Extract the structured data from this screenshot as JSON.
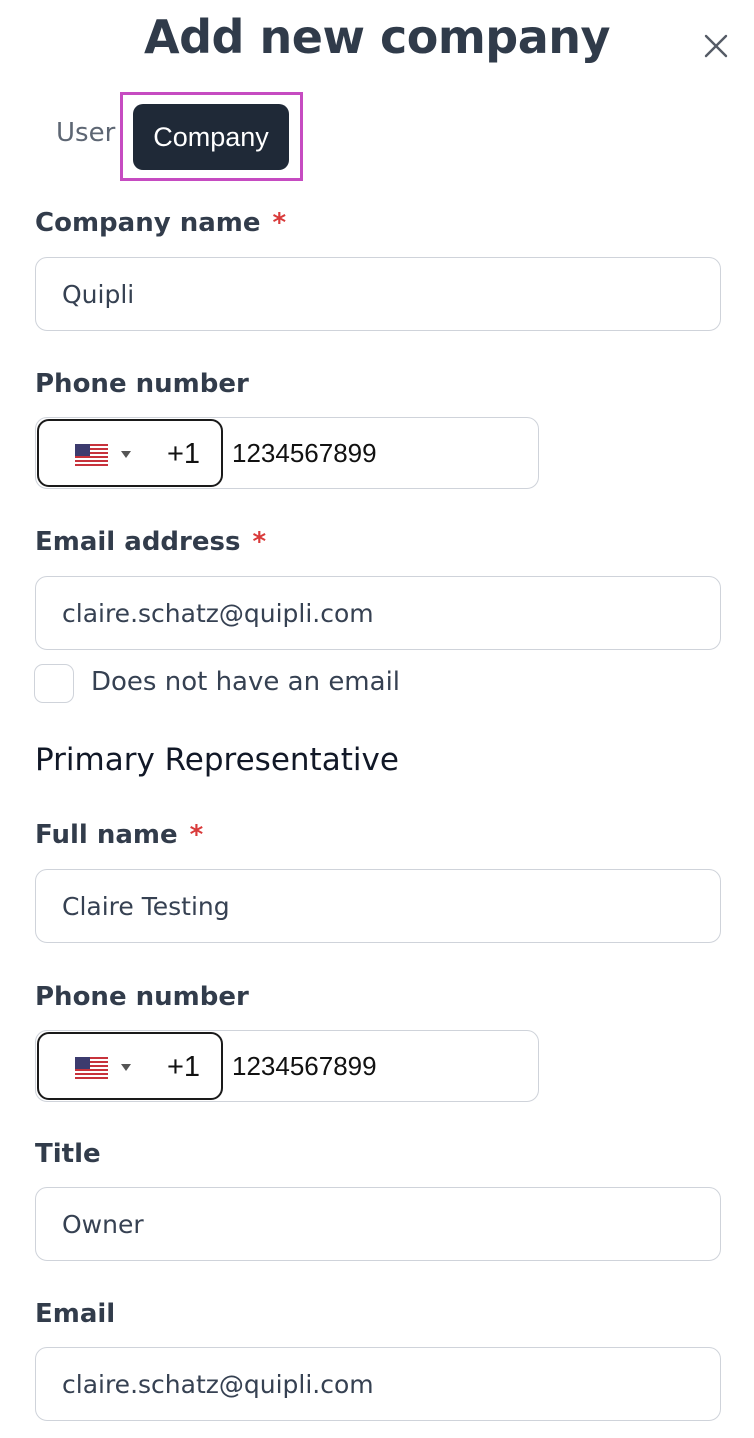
{
  "header": {
    "title": "Add new company"
  },
  "tabs": [
    {
      "label": "User",
      "selected": false
    },
    {
      "label": "Company",
      "selected": true
    }
  ],
  "company": {
    "name_label": "Company name",
    "name_value": "Quipli",
    "phone_label": "Phone number",
    "phone_country": "US",
    "phone_dial_code": "+1",
    "phone_value": "1234567899",
    "email_label": "Email address",
    "email_value": "claire.schatz@quipli.com",
    "no_email_label": "Does not have an email",
    "no_email_checked": false
  },
  "representative": {
    "heading": "Primary Representative",
    "full_name_label": "Full name",
    "full_name_value": "Claire Testing",
    "phone_label": "Phone number",
    "phone_country": "US",
    "phone_dial_code": "+1",
    "phone_value": "1234567899",
    "title_label": "Title",
    "title_value": "Owner",
    "email_label": "Email",
    "email_value": "claire.schatz@quipli.com"
  },
  "required_marker": "*",
  "icons": {
    "close": "close-icon",
    "flag": "us-flag-icon",
    "dropdown": "chevron-down-icon"
  },
  "colors": {
    "title_text": "#303b4a",
    "tab_selected_bg": "#1f2937",
    "tab_highlight_border": "#c64bc1",
    "required_asterisk": "#d93a3a",
    "input_border": "#cfd3da"
  }
}
